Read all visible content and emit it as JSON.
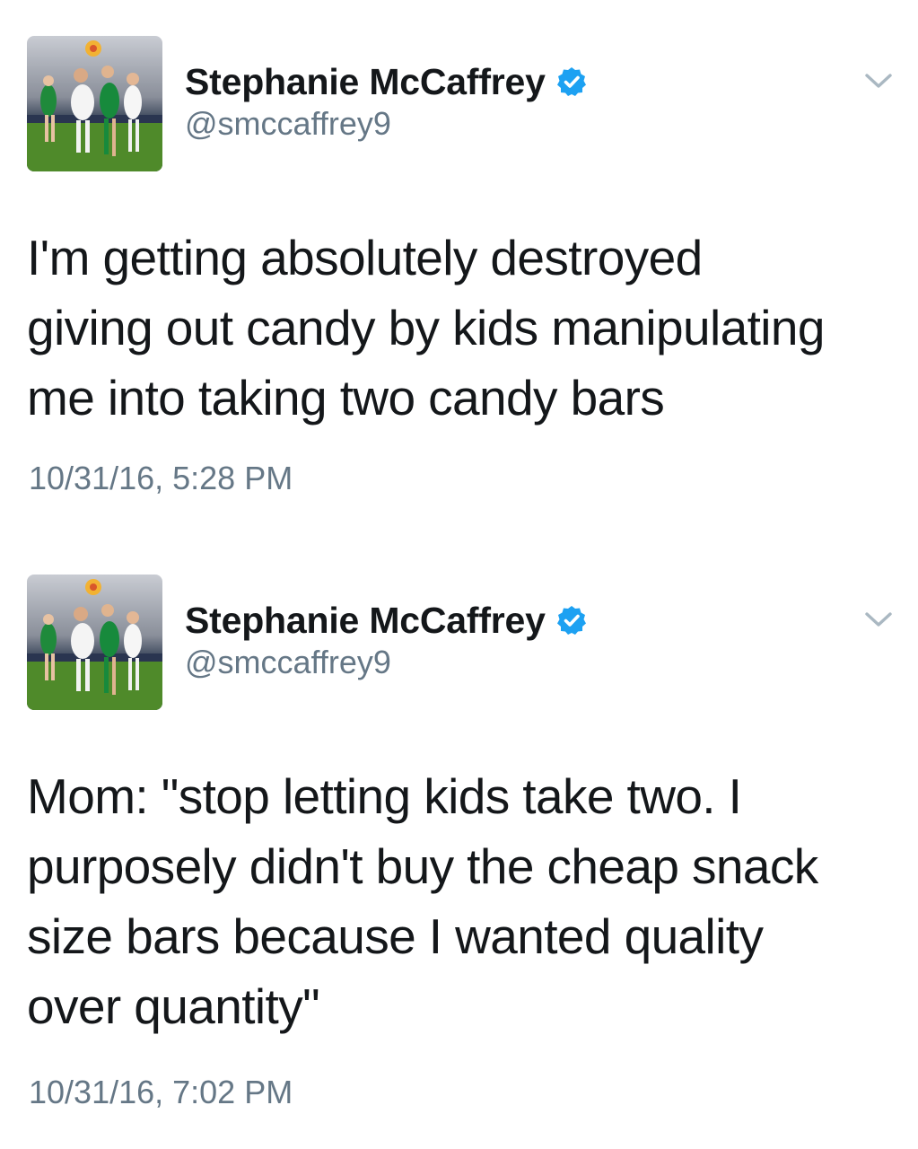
{
  "tweets": [
    {
      "author": {
        "display_name": "Stephanie McCaffrey",
        "handle": "@smccaffrey9",
        "verified_icon": "verified-badge-icon",
        "avatar": "profile-photo-soccer"
      },
      "text_lines": [
        "I'm getting absolutely destroyed",
        "giving out candy by kids manipulating",
        "me into taking two candy bars"
      ],
      "timestamp": "10/31/16, 5:28 PM",
      "menu_icon": "chevron-down-icon"
    },
    {
      "author": {
        "display_name": "Stephanie McCaffrey",
        "handle": "@smccaffrey9",
        "verified_icon": "verified-badge-icon",
        "avatar": "profile-photo-soccer"
      },
      "text_lines": [
        "Mom: \"stop letting kids take two. I",
        "purposely didn't buy the cheap snack",
        "size bars because I wanted quality",
        "over quantity\""
      ],
      "timestamp": "10/31/16, 7:02 PM",
      "menu_icon": "chevron-down-icon"
    }
  ],
  "colors": {
    "text": "#14171a",
    "secondary_text": "#657786",
    "verified_blue": "#1da1f2",
    "chevron": "#aab8c2"
  }
}
